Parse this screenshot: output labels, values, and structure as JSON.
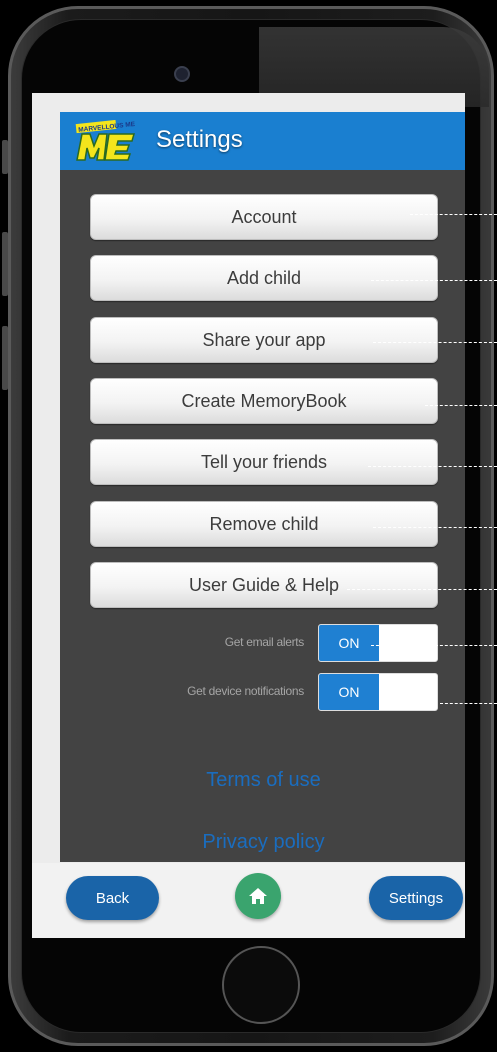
{
  "header": {
    "title": "Settings",
    "logo_text": "MARVELLOUS ME"
  },
  "menu": {
    "items": [
      {
        "label": "Account"
      },
      {
        "label": "Add child"
      },
      {
        "label": "Share your app"
      },
      {
        "label": "Create MemoryBook"
      },
      {
        "label": "Tell your friends"
      },
      {
        "label": "Remove child"
      },
      {
        "label": "User Guide & Help"
      }
    ]
  },
  "toggles": [
    {
      "label": "Get email alerts",
      "state": "ON"
    },
    {
      "label": "Get device notifications",
      "state": "ON"
    }
  ],
  "links": {
    "terms": "Terms of use",
    "privacy": "Privacy policy"
  },
  "bottom_bar": {
    "back": "Back",
    "settings": "Settings",
    "home_icon": "home-icon"
  },
  "colors": {
    "header_blue": "#1a7fd0",
    "panel_dark": "#434343",
    "toggle_blue": "#1f80d2",
    "pill_blue": "#1a64a8",
    "home_green": "#3aa46e",
    "link_blue": "#1a6dbf"
  }
}
